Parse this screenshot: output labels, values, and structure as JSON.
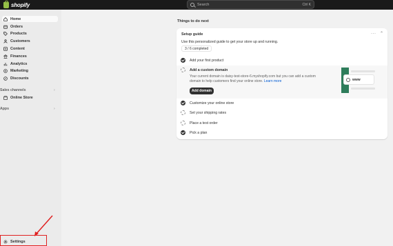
{
  "header": {
    "logo_text": "shopify",
    "search_placeholder": "Search",
    "search_shortcut": "Ctrl K"
  },
  "sidebar": {
    "items": [
      {
        "label": "Home",
        "icon": "home-icon"
      },
      {
        "label": "Orders",
        "icon": "orders-icon"
      },
      {
        "label": "Products",
        "icon": "tag-icon"
      },
      {
        "label": "Customers",
        "icon": "person-icon"
      },
      {
        "label": "Content",
        "icon": "content-icon"
      },
      {
        "label": "Finances",
        "icon": "bank-icon"
      },
      {
        "label": "Analytics",
        "icon": "chart-icon"
      },
      {
        "label": "Marketing",
        "icon": "target-icon"
      },
      {
        "label": "Discounts",
        "icon": "discount-icon"
      }
    ],
    "sales_channels_label": "Sales channels",
    "online_store_label": "Online Store",
    "apps_label": "Apps",
    "settings_label": "Settings"
  },
  "main": {
    "section_title": "Things to do next",
    "setup_guide": {
      "title": "Setup guide",
      "description": "Use this personalized guide to get your store up and running.",
      "progress": "3 / 6 completed",
      "tasks": [
        {
          "label": "Add your first product",
          "done": true
        },
        {
          "label": "Add a custom domain",
          "done": false
        },
        {
          "label": "Customize your online store",
          "done": true
        },
        {
          "label": "Set your shipping rates",
          "done": false
        },
        {
          "label": "Place a test order",
          "done": false
        },
        {
          "label": "Pick a plan",
          "done": true
        }
      ],
      "expanded_text": "Your current domain is daisy-test-store-6.myshopify.com but you can add a custom domain to help customers find your online store.",
      "learn_more": "Learn more",
      "add_domain_button": "Add domain",
      "illustration_text": "www"
    }
  },
  "colors": {
    "topbar": "#1a1a1a",
    "sidebar": "#ebebeb",
    "accent_green": "#2e7d5b",
    "annotation_red": "#e02020"
  }
}
